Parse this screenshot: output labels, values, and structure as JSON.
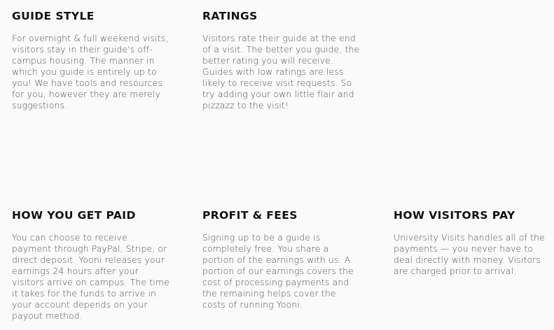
{
  "sections": {
    "guide_style": {
      "title": "GUIDE STYLE",
      "body": "For overnight & full weekend visits, visitors stay in their guide's off-campus housing. The manner in which you guide is entirely up to you! We have tools and resources for you, however they are merely suggestions."
    },
    "ratings": {
      "title": "RATINGS",
      "body": "Visitors rate their guide at the end of a visit. The better you guide, the better rating you will receive. Guides with low ratings are less likely to receive visit requests. So try adding your own little flair and pizzazz to the visit!"
    },
    "how_you_get_paid": {
      "title": "HOW YOU GET PAID",
      "body": "You can choose to receive payment through PayPal, Stripe, or direct deposit. Yooni releases your earnings 24 hours after your visitors arrive on campus. The time it takes for the funds to arrive in your account depends on your payout method."
    },
    "profit_fees": {
      "title": "PROFIT & FEES",
      "body": "Signing up to be a guide is completely free. You share a portion of the earnings with us. A portion of our earnings covers the cost of processing payments and the remaining helps cover the costs of running Yooni."
    },
    "how_visitors_pay": {
      "title": "HOW VISITORS PAY",
      "body": "University Visits handles all of the payments — you never have to deal directly with money. Visitors are charged prior to arrival."
    }
  }
}
